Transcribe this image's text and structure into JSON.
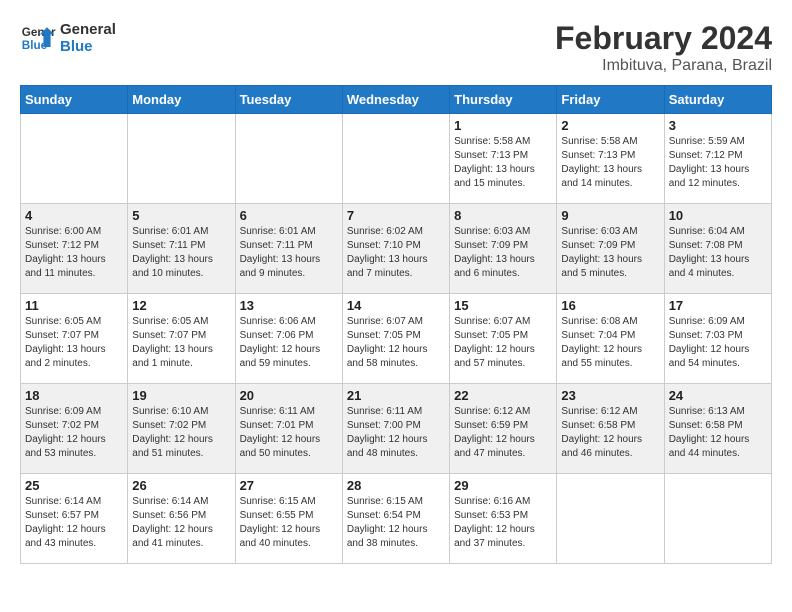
{
  "logo": {
    "line1": "General",
    "line2": "Blue"
  },
  "title": "February 2024",
  "subtitle": "Imbituva, Parana, Brazil",
  "weekdays": [
    "Sunday",
    "Monday",
    "Tuesday",
    "Wednesday",
    "Thursday",
    "Friday",
    "Saturday"
  ],
  "weeks": [
    [
      {
        "day": "",
        "info": ""
      },
      {
        "day": "",
        "info": ""
      },
      {
        "day": "",
        "info": ""
      },
      {
        "day": "",
        "info": ""
      },
      {
        "day": "1",
        "info": "Sunrise: 5:58 AM\nSunset: 7:13 PM\nDaylight: 13 hours and 15 minutes."
      },
      {
        "day": "2",
        "info": "Sunrise: 5:58 AM\nSunset: 7:13 PM\nDaylight: 13 hours and 14 minutes."
      },
      {
        "day": "3",
        "info": "Sunrise: 5:59 AM\nSunset: 7:12 PM\nDaylight: 13 hours and 12 minutes."
      }
    ],
    [
      {
        "day": "4",
        "info": "Sunrise: 6:00 AM\nSunset: 7:12 PM\nDaylight: 13 hours and 11 minutes."
      },
      {
        "day": "5",
        "info": "Sunrise: 6:01 AM\nSunset: 7:11 PM\nDaylight: 13 hours and 10 minutes."
      },
      {
        "day": "6",
        "info": "Sunrise: 6:01 AM\nSunset: 7:11 PM\nDaylight: 13 hours and 9 minutes."
      },
      {
        "day": "7",
        "info": "Sunrise: 6:02 AM\nSunset: 7:10 PM\nDaylight: 13 hours and 7 minutes."
      },
      {
        "day": "8",
        "info": "Sunrise: 6:03 AM\nSunset: 7:09 PM\nDaylight: 13 hours and 6 minutes."
      },
      {
        "day": "9",
        "info": "Sunrise: 6:03 AM\nSunset: 7:09 PM\nDaylight: 13 hours and 5 minutes."
      },
      {
        "day": "10",
        "info": "Sunrise: 6:04 AM\nSunset: 7:08 PM\nDaylight: 13 hours and 4 minutes."
      }
    ],
    [
      {
        "day": "11",
        "info": "Sunrise: 6:05 AM\nSunset: 7:07 PM\nDaylight: 13 hours and 2 minutes."
      },
      {
        "day": "12",
        "info": "Sunrise: 6:05 AM\nSunset: 7:07 PM\nDaylight: 13 hours and 1 minute."
      },
      {
        "day": "13",
        "info": "Sunrise: 6:06 AM\nSunset: 7:06 PM\nDaylight: 12 hours and 59 minutes."
      },
      {
        "day": "14",
        "info": "Sunrise: 6:07 AM\nSunset: 7:05 PM\nDaylight: 12 hours and 58 minutes."
      },
      {
        "day": "15",
        "info": "Sunrise: 6:07 AM\nSunset: 7:05 PM\nDaylight: 12 hours and 57 minutes."
      },
      {
        "day": "16",
        "info": "Sunrise: 6:08 AM\nSunset: 7:04 PM\nDaylight: 12 hours and 55 minutes."
      },
      {
        "day": "17",
        "info": "Sunrise: 6:09 AM\nSunset: 7:03 PM\nDaylight: 12 hours and 54 minutes."
      }
    ],
    [
      {
        "day": "18",
        "info": "Sunrise: 6:09 AM\nSunset: 7:02 PM\nDaylight: 12 hours and 53 minutes."
      },
      {
        "day": "19",
        "info": "Sunrise: 6:10 AM\nSunset: 7:02 PM\nDaylight: 12 hours and 51 minutes."
      },
      {
        "day": "20",
        "info": "Sunrise: 6:11 AM\nSunset: 7:01 PM\nDaylight: 12 hours and 50 minutes."
      },
      {
        "day": "21",
        "info": "Sunrise: 6:11 AM\nSunset: 7:00 PM\nDaylight: 12 hours and 48 minutes."
      },
      {
        "day": "22",
        "info": "Sunrise: 6:12 AM\nSunset: 6:59 PM\nDaylight: 12 hours and 47 minutes."
      },
      {
        "day": "23",
        "info": "Sunrise: 6:12 AM\nSunset: 6:58 PM\nDaylight: 12 hours and 46 minutes."
      },
      {
        "day": "24",
        "info": "Sunrise: 6:13 AM\nSunset: 6:58 PM\nDaylight: 12 hours and 44 minutes."
      }
    ],
    [
      {
        "day": "25",
        "info": "Sunrise: 6:14 AM\nSunset: 6:57 PM\nDaylight: 12 hours and 43 minutes."
      },
      {
        "day": "26",
        "info": "Sunrise: 6:14 AM\nSunset: 6:56 PM\nDaylight: 12 hours and 41 minutes."
      },
      {
        "day": "27",
        "info": "Sunrise: 6:15 AM\nSunset: 6:55 PM\nDaylight: 12 hours and 40 minutes."
      },
      {
        "day": "28",
        "info": "Sunrise: 6:15 AM\nSunset: 6:54 PM\nDaylight: 12 hours and 38 minutes."
      },
      {
        "day": "29",
        "info": "Sunrise: 6:16 AM\nSunset: 6:53 PM\nDaylight: 12 hours and 37 minutes."
      },
      {
        "day": "",
        "info": ""
      },
      {
        "day": "",
        "info": ""
      }
    ]
  ]
}
